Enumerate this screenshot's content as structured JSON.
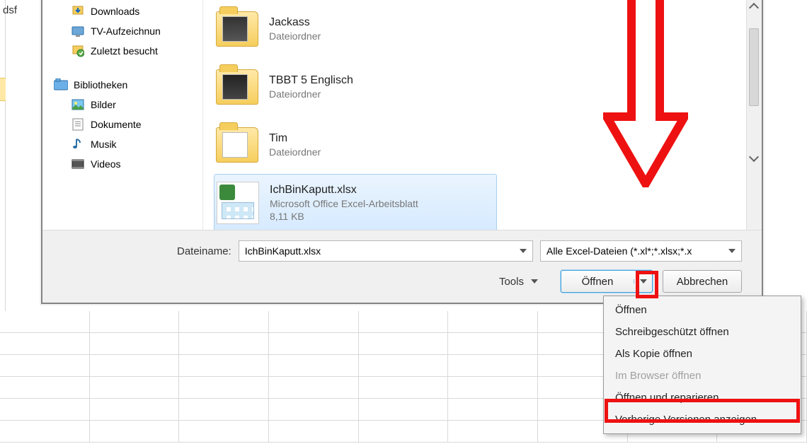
{
  "sheet": {
    "sample_cell": "dsf"
  },
  "sidebar": {
    "items": [
      {
        "label": "Downloads",
        "icon": "downloads-icon"
      },
      {
        "label": "TV-Aufzeichnun",
        "icon": "tv-icon"
      },
      {
        "label": "Zuletzt besucht",
        "icon": "recent-icon"
      }
    ],
    "group_label": "Bibliotheken",
    "libs": [
      {
        "label": "Bilder",
        "icon": "pictures-icon"
      },
      {
        "label": "Dokumente",
        "icon": "documents-icon"
      },
      {
        "label": "Musik",
        "icon": "music-icon"
      },
      {
        "label": "Videos",
        "icon": "videos-icon"
      }
    ]
  },
  "files": [
    {
      "name": "Jackass",
      "sub": "Dateiordner"
    },
    {
      "name": "TBBT 5 Englisch",
      "sub": "Dateiordner"
    },
    {
      "name": "Tim",
      "sub": "Dateiordner"
    },
    {
      "name": "IchBinKaputt.xlsx",
      "sub": "Microsoft Office Excel-Arbeitsblatt",
      "size": "8,11 KB",
      "selected": true
    }
  ],
  "bottom": {
    "filename_label": "Dateiname:",
    "filename_value": "IchBinKaputt.xlsx",
    "filter_value": "Alle Excel-Dateien (*.xl*;*.xlsx;*.x",
    "tools_label": "Tools",
    "open_label": "Öffnen",
    "cancel_label": "Abbrechen"
  },
  "menu": {
    "items": [
      {
        "label": "Öffnen"
      },
      {
        "label": "Schreibgeschützt öffnen"
      },
      {
        "label": "Als Kopie öffnen"
      },
      {
        "label": "Im Browser öffnen",
        "disabled": true
      },
      {
        "label": "Öffnen und reparieren...",
        "highlight": true
      },
      {
        "label": "Vorherige Versionen anzeigen"
      }
    ]
  }
}
